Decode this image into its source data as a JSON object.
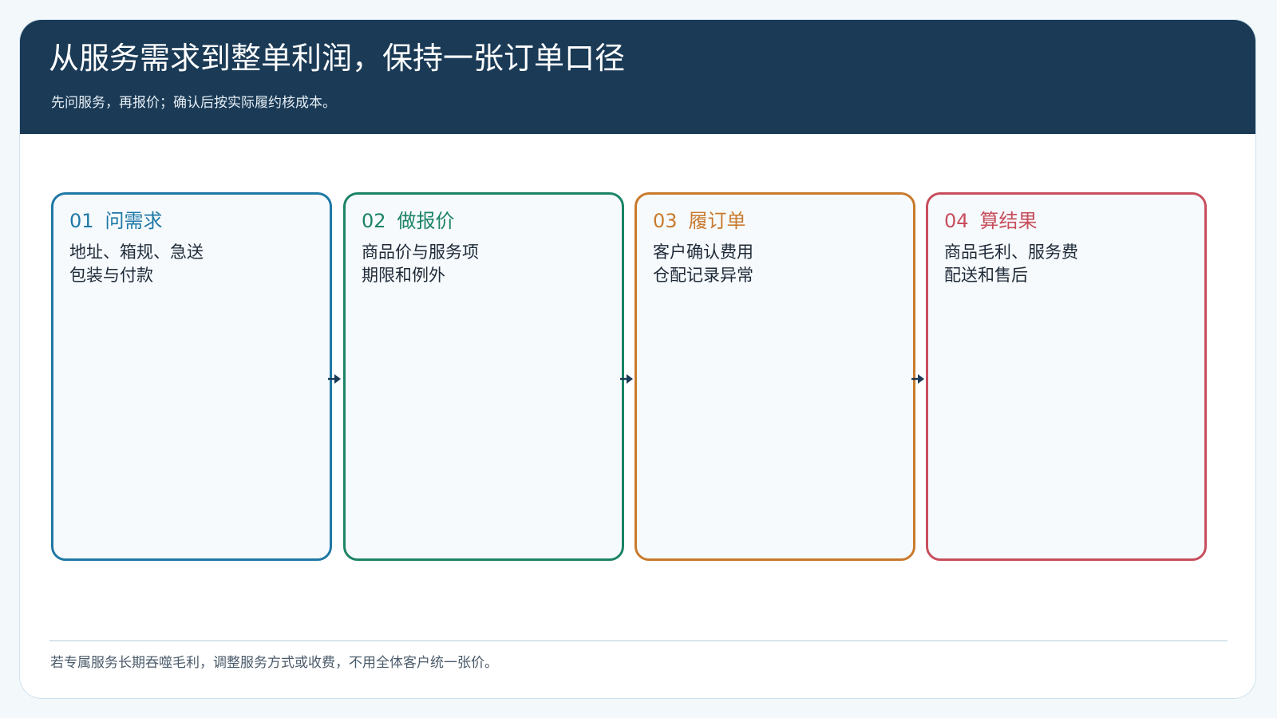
{
  "header": {
    "title": "从服务需求到整单利润，保持一张订单口径",
    "subtitle": "先问服务，再报价；确认后按实际履约核成本。"
  },
  "steps": [
    {
      "number": "01",
      "title": "问需求",
      "lines": [
        "地址、箱规、急送",
        "包装与付款"
      ],
      "color": "#1f78a6"
    },
    {
      "number": "02",
      "title": "做报价",
      "lines": [
        "商品价与服务项",
        "期限和例外"
      ],
      "color": "#1c8366"
    },
    {
      "number": "03",
      "title": "履订单",
      "lines": [
        "客户确认费用",
        "仓配记录异常"
      ],
      "color": "#c97a2d"
    },
    {
      "number": "04",
      "title": "算结果",
      "lines": [
        "商品毛利、服务费",
        "配送和售后"
      ],
      "color": "#c84e5d"
    }
  ],
  "arrow_icon": "arrow-right-icon",
  "footnote": "若专属服务长期吞噬毛利，调整服务方式或收费，不用全体客户统一张价。"
}
